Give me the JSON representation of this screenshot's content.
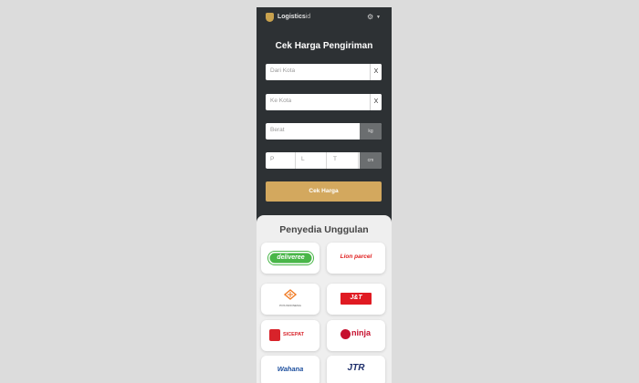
{
  "header": {
    "brand_bold": "Logistics",
    "brand_light": "id",
    "settings_icon": "gear-icon",
    "caret_icon": "chevron-down-icon"
  },
  "form": {
    "title": "Cek Harga Pengiriman",
    "from_placeholder": "Dari Kota",
    "to_placeholder": "Ke Kota",
    "clear_label": "X",
    "weight_placeholder": "Berat",
    "weight_unit": "kg",
    "dim_p": "P",
    "dim_l": "L",
    "dim_t": "T",
    "dim_unit": "cm",
    "submit_label": "Cek Harga"
  },
  "providers": {
    "title": "Penyedia Unggulan",
    "items": [
      {
        "name": "deliveree",
        "color": "#49b648"
      },
      {
        "name": "Lion parcel",
        "color": "#e02020"
      },
      {
        "name": "POS INDONESIA",
        "color": "#f07a22"
      },
      {
        "name": "J&T",
        "color": "#e01a22"
      },
      {
        "name": "SICEPAT",
        "color": "#d8232a"
      },
      {
        "name": "ninja",
        "color": "#c6102e"
      },
      {
        "name": "Wahana",
        "color": "#1d4f9e"
      },
      {
        "name": "JTR",
        "color": "#1e2f6b"
      }
    ]
  },
  "colors": {
    "background": "#dcdcdc",
    "panel": "#2d3134",
    "accent": "#d3a85e",
    "card_area": "#efefef"
  }
}
